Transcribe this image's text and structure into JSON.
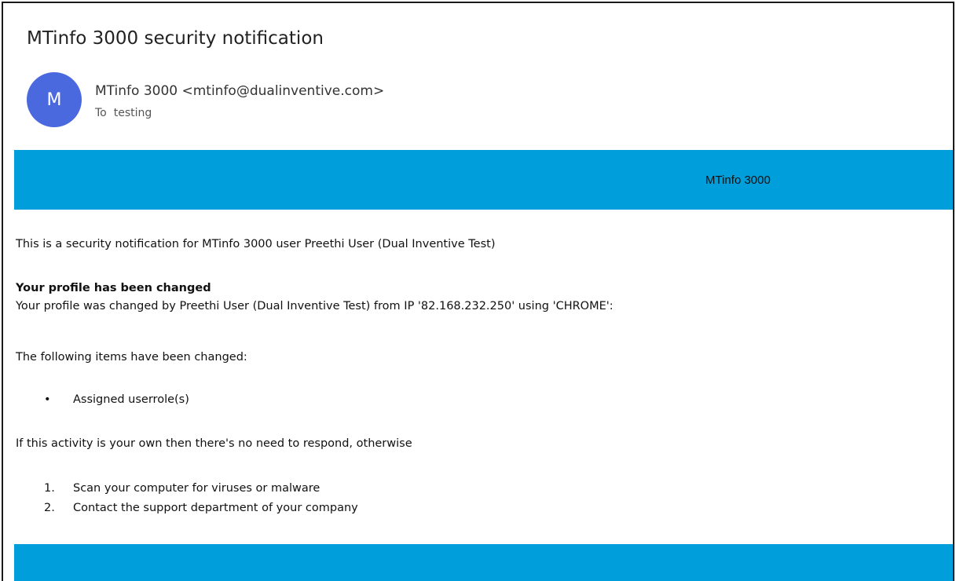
{
  "email": {
    "subject": "MTinfo 3000 security notification",
    "avatar_letter": "M",
    "sender": "MTinfo 3000 <mtinfo@dualinventive.com>",
    "to_label": "To",
    "to_value": "testing"
  },
  "banner": {
    "brand": "MTinfo 3000",
    "color": "#009edb"
  },
  "message": {
    "intro": "This is a security notification for MTinfo 3000 user Preethi User (Dual Inventive Test)",
    "heading": "Your profile has been changed",
    "changed_by": "Your profile was changed by Preethi User (Dual Inventive Test) from IP '82.168.232.250' using 'CHROME':",
    "items_intro": "The following items have been changed:",
    "items": [
      {
        "marker": "•",
        "text": "Assigned userrole(s)"
      }
    ],
    "advice_intro": "If this activity is your own then there's no need to respond, otherwise",
    "steps": [
      {
        "marker": "1.",
        "text": "Scan your computer for viruses or malware"
      },
      {
        "marker": "2.",
        "text": "Contact the support department of your company"
      }
    ]
  },
  "colors": {
    "avatar": "#4b69df",
    "accent": "#009edb"
  }
}
